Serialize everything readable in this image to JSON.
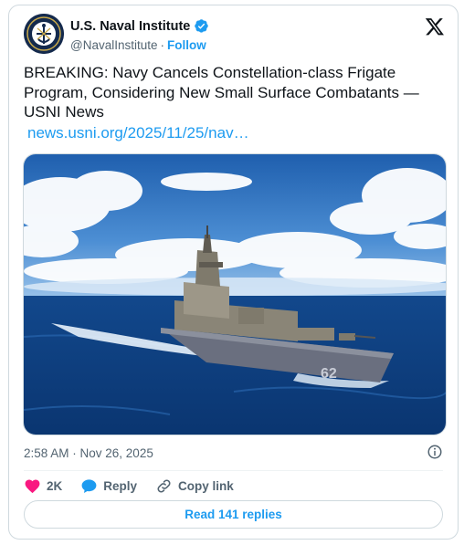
{
  "account": {
    "display_name": "U.S. Naval Institute",
    "handle": "@NavalInstitute",
    "separator": "·",
    "follow_label": "Follow"
  },
  "tweet": {
    "text": "BREAKING: Navy Cancels Constellation-class Frigate Program, Considering New Small Surface Combatants — USNI News",
    "link": "news.usni.org/2025/11/25/nav…",
    "timestamp": "2:58 AM · Nov 26, 2025"
  },
  "media": {
    "hull_number": "62"
  },
  "actions": {
    "like_count": "2K",
    "reply_label": "Reply",
    "copy_link_label": "Copy link"
  },
  "footer": {
    "read_replies_label": "Read 141 replies"
  },
  "colors": {
    "accent": "#1d9bf0",
    "like": "#f91880",
    "text": "#0f1419",
    "muted": "#536471"
  }
}
